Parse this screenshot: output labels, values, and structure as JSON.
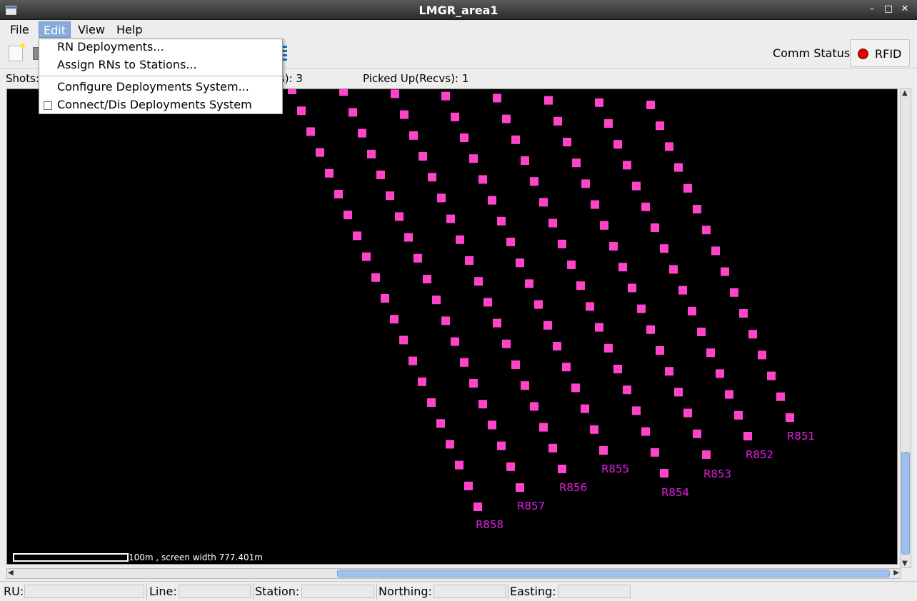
{
  "window": {
    "title": "LMGR_area1",
    "min_symbol": "–",
    "max_symbol": "□",
    "close_symbol": "✕"
  },
  "menu": {
    "file": "File",
    "edit": "Edit",
    "view": "View",
    "help": "Help"
  },
  "edit_menu": {
    "rn_deployments": "RN Deployments...",
    "assign_rns": "Assign RNs to Stations...",
    "configure": "Configure Deployments System...",
    "connect": "Connect/Dis Deployments System",
    "connect_checked": false
  },
  "toolbar": {
    "comm_status_label": "Comm Status:",
    "rfid_label": "RFID",
    "rfid_status_color": "#e00000"
  },
  "stats": {
    "shots_label": "Shots:",
    "deployed_tail": "vs): 3",
    "picked_up": "Picked Up(Recvs): 1"
  },
  "map": {
    "marker_color": "#ff44c8",
    "label_color": "#e020e0",
    "lines": [
      {
        "name": "R851",
        "count": 16
      },
      {
        "name": "R852",
        "count": 18
      },
      {
        "name": "R853",
        "count": 19
      },
      {
        "name": "R854",
        "count": 20
      },
      {
        "name": "R855",
        "count": 20
      },
      {
        "name": "R856",
        "count": 20
      },
      {
        "name": "R857",
        "count": 21
      },
      {
        "name": "R858",
        "count": 23
      }
    ],
    "scale_text": "100m , screen width 777.401m"
  },
  "statusbar": {
    "ru_label": "RU:",
    "ru_value": "",
    "line_label": "Line:",
    "line_value": "",
    "station_label": "Station:",
    "station_value": "",
    "northing_label": "Northing:",
    "northing_value": "",
    "easting_label": "Easting:",
    "easting_value": ""
  }
}
